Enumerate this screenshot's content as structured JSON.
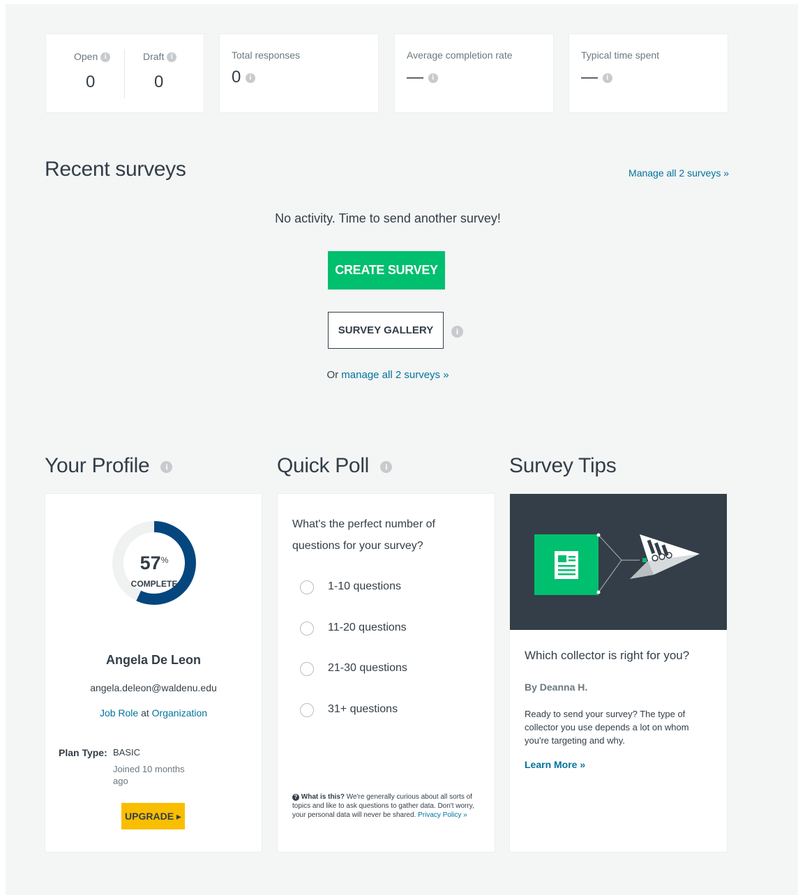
{
  "stats": {
    "open_label": "Open",
    "open_value": "0",
    "draft_label": "Draft",
    "draft_value": "0",
    "total_responses_label": "Total responses",
    "total_responses_value": "0",
    "avg_completion_label": "Average completion rate",
    "avg_completion_value": "—",
    "typical_time_label": "Typical time spent",
    "typical_time_value": "—"
  },
  "recent": {
    "title": "Recent surveys",
    "manage_link": "Manage all 2 surveys »",
    "empty_message": "No activity. Time to send another survey!",
    "create_button": "CREATE SURVEY",
    "gallery_button": "SURVEY GALLERY",
    "or_text": "Or",
    "or_link": "manage all 2 surveys »"
  },
  "profile": {
    "title": "Your Profile",
    "progress_percent": 57,
    "progress_value": "57",
    "progress_unit": "%",
    "progress_label": "COMPLETE",
    "name": "Angela De Leon",
    "email": "angela.deleon@waldenu.edu",
    "job_role_link": "Job Role",
    "at_text": "at",
    "organization_link": "Organization",
    "plan_type_label": "Plan Type:",
    "plan_type_value": "BASIC",
    "joined_text": "Joined 10 months ago",
    "upgrade_button": "UPGRADE ▸"
  },
  "poll": {
    "title": "Quick Poll",
    "question": "What's the perfect number of questions for your survey?",
    "options": [
      "1-10 questions",
      "11-20 questions",
      "21-30 questions",
      "31+ questions"
    ],
    "footer_bold": "What is this?",
    "footer_text": "We're generally curious about all sorts of topics and like to ask questions to gather data. Don't worry, your personal data will never be shared.",
    "footer_link": "Privacy Policy »"
  },
  "tips": {
    "title": "Survey Tips",
    "article_title": "Which collector is right for you?",
    "author": "By Deanna H.",
    "description": "Ready to send your survey? The type of collector you use depends a lot on whom you're targeting and why.",
    "learn_more": "Learn More »"
  },
  "colors": {
    "green": "#00bf6f",
    "navy": "#05467e",
    "yellow": "#f9be00",
    "link": "#00739d",
    "dark_panel": "#333e48"
  }
}
